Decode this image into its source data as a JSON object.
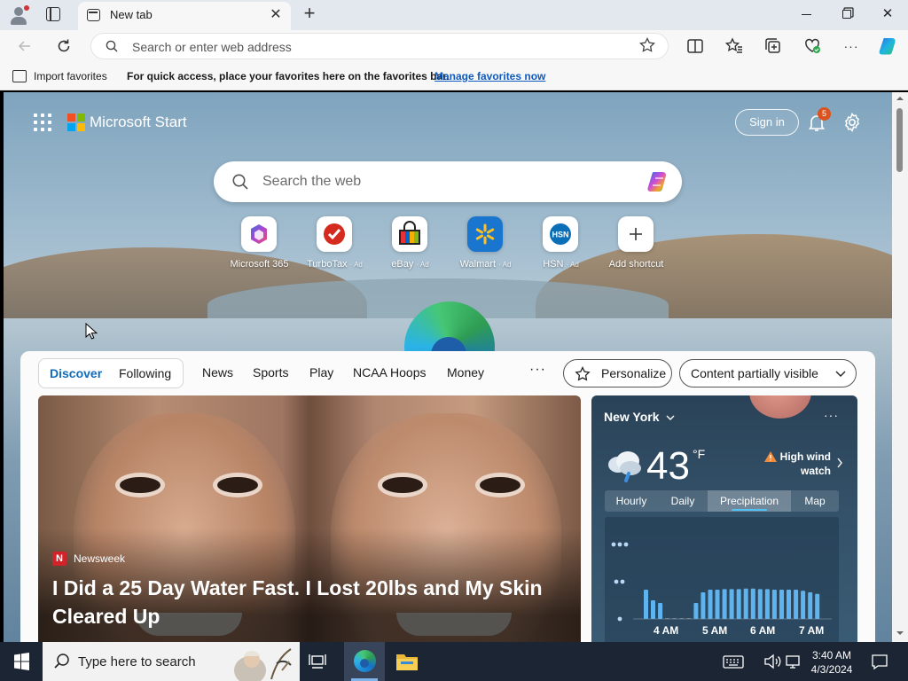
{
  "browser": {
    "tab_title": "New tab",
    "close_tab": "✕",
    "new_tab": "+",
    "address_placeholder": "Search or enter web address"
  },
  "favorites_bar": {
    "import_label": "Import favorites",
    "message": "For quick access, place your favorites here on the favorites bar.",
    "manage_link": "Manage favorites now"
  },
  "ms_start": {
    "title": "Microsoft Start",
    "sign_in": "Sign in",
    "notification_count": "5",
    "search_placeholder": "Search the web",
    "brand_colors": [
      "#f25022",
      "#7fba00",
      "#00a4ef",
      "#ffb900"
    ]
  },
  "shortcuts": [
    {
      "label": "Microsoft 365",
      "ad": "",
      "icon": "microsoft-365-icon"
    },
    {
      "label": "TurboTax",
      "ad": "· Ad",
      "icon": "turbotax-icon"
    },
    {
      "label": "eBay",
      "ad": "· Ad",
      "icon": "ebay-icon"
    },
    {
      "label": "Walmart",
      "ad": "· Ad",
      "icon": "walmart-icon"
    },
    {
      "label": "HSN",
      "ad": "· Ad",
      "icon": "hsn-icon"
    },
    {
      "label": "Add shortcut",
      "ad": "",
      "icon": "plus-icon"
    }
  ],
  "feed_nav": {
    "discover": "Discover",
    "following": "Following",
    "items": [
      "News",
      "Sports",
      "Play",
      "NCAA Hoops",
      "Money"
    ],
    "more": "···",
    "personalize": "Personalize",
    "content_visibility": "Content partially visible"
  },
  "hero": {
    "source_icon": "N",
    "source": "Newsweek",
    "headline": "I Did a 25 Day Water Fast. I Lost 20lbs and My Skin Cleared Up"
  },
  "weather": {
    "city": "New York",
    "more": "···",
    "temperature": "43",
    "unit": "°F",
    "alert": "High wind watch",
    "tabs": [
      "Hourly",
      "Daily",
      "Precipitation",
      "Map"
    ],
    "active_tab": "Precipitation",
    "chart_times": [
      "4 AM",
      "5 AM",
      "6 AM",
      "7 AM"
    ],
    "precip_bars": [
      0.55,
      0.35,
      0.3,
      0,
      0,
      0,
      0,
      0.3,
      0.5,
      0.55,
      0.55,
      0.56,
      0.56,
      0.56,
      0.57,
      0.57,
      0.56,
      0.56,
      0.55,
      0.55,
      0.55,
      0.55,
      0.53,
      0.5,
      0.47
    ]
  },
  "taskbar": {
    "search_placeholder": "Type here to search",
    "time": "3:40 AM",
    "date": "4/3/2024"
  }
}
